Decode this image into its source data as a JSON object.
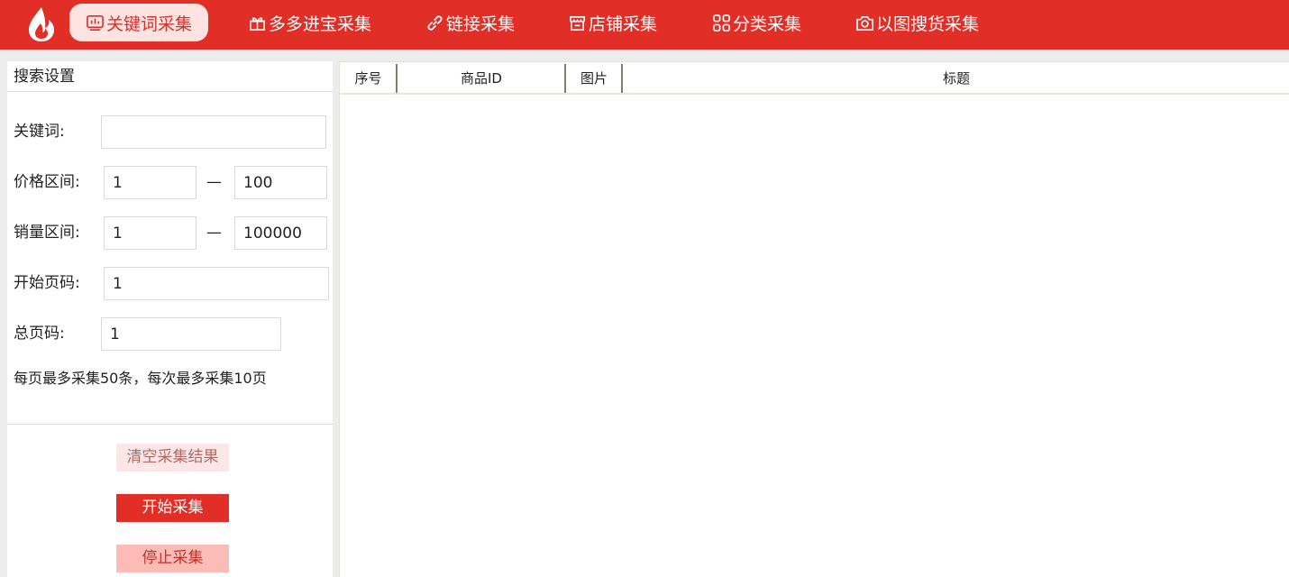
{
  "nav": {
    "items": [
      {
        "label": "关键词采集",
        "icon": "chart-icon",
        "active": true
      },
      {
        "label": "多多进宝采集",
        "icon": "gift-icon",
        "active": false
      },
      {
        "label": "链接采集",
        "icon": "link-icon",
        "active": false
      },
      {
        "label": "店铺采集",
        "icon": "shop-icon",
        "active": false
      },
      {
        "label": "分类采集",
        "icon": "grid-icon",
        "active": false
      },
      {
        "label": "以图搜货采集",
        "icon": "camera-icon",
        "active": false
      }
    ]
  },
  "search": {
    "title": "搜索设置",
    "keyword_label": "关键词:",
    "keyword_value": "",
    "price_label": "价格区间:",
    "price_min": "1",
    "price_max": "100",
    "sales_label": "销量区间:",
    "sales_min": "1",
    "sales_max": "100000",
    "start_page_label": "开始页码:",
    "start_page": "1",
    "total_pages_label": "总页码:",
    "total_pages": "1",
    "range_separator": "—",
    "hint": "每页最多采集50条，每次最多采集10页"
  },
  "actions": {
    "clear_label": "清空采集结果",
    "start_label": "开始采集",
    "stop_label": "停止采集"
  },
  "table": {
    "columns": [
      "序号",
      "商品ID",
      "图片",
      "标题"
    ]
  },
  "colors": {
    "brand": "#e12f28",
    "active_tab_bg": "#ffe3e1"
  }
}
